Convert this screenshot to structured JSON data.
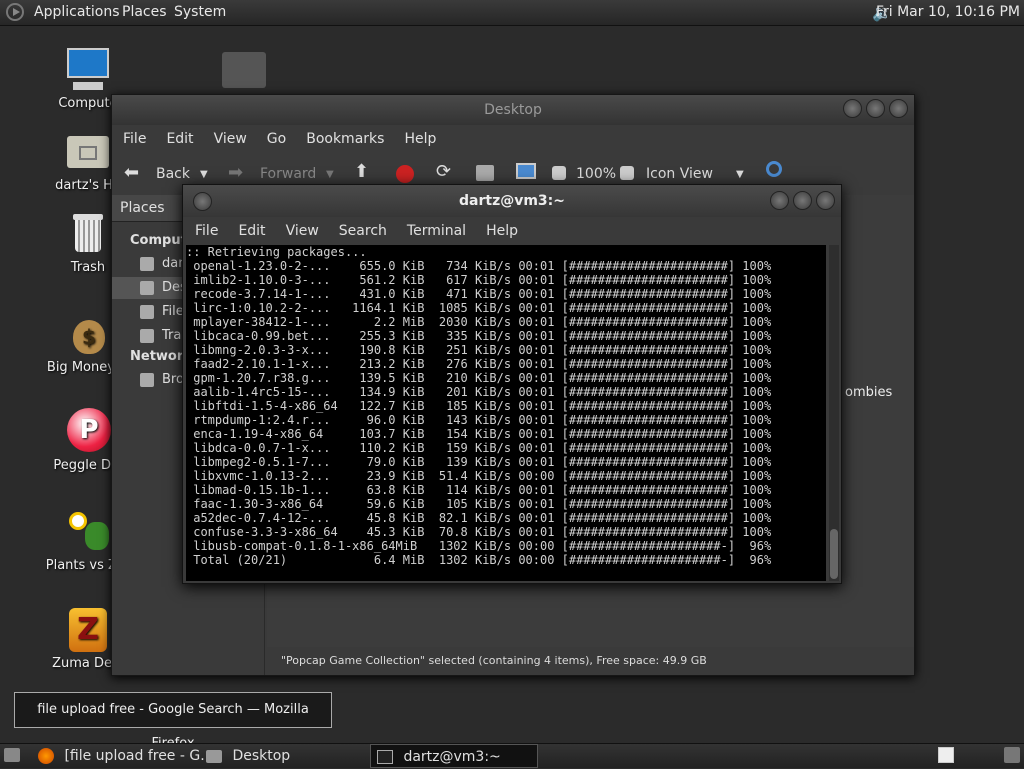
{
  "top_panel": {
    "menus": [
      "Applications",
      "Places",
      "System"
    ],
    "clock": "Fri Mar 10, 10:16 PM"
  },
  "desktop_icons": [
    {
      "label": "Compute",
      "icon": "computer-icon"
    },
    {
      "label": "dartz's Ho",
      "icon": "home-folder-icon"
    },
    {
      "label": "Trash",
      "icon": "trash-icon"
    },
    {
      "label": "Big Money D",
      "icon": "money-bag-icon"
    },
    {
      "label": "Peggle Del",
      "icon": "peggle-icon"
    },
    {
      "label": "Plants vs Zor",
      "icon": "plants-vs-zombies-icon"
    },
    {
      "label": "Zuma Delu",
      "icon": "zuma-icon"
    }
  ],
  "nautilus": {
    "title": "Desktop",
    "menus": [
      "File",
      "Edit",
      "View",
      "Go",
      "Bookmarks",
      "Help"
    ],
    "toolbar": {
      "back": "Back",
      "forward": "Forward",
      "zoom": "100%",
      "view_mode": "Icon View"
    },
    "sidebar": {
      "header": "Places",
      "section_computer": "Compute",
      "items_computer": [
        "dar",
        "Des",
        "File",
        "Tra"
      ],
      "section_network": "Network",
      "items_network": [
        "Bro"
      ]
    },
    "main_item_label": "ombies",
    "status": "\"Popcap Game Collection\" selected (containing 4 items), Free space: 49.9 GB"
  },
  "terminal": {
    "title": "dartz@vm3:~",
    "menus": [
      "File",
      "Edit",
      "View",
      "Search",
      "Terminal",
      "Help"
    ],
    "lines": [
      ":: Retrieving packages...",
      " openal-1.23.0-2-...    655.0 KiB   734 KiB/s 00:01 [######################] 100%",
      " imlib2-1.10.0-3-...    561.2 KiB   617 KiB/s 00:01 [######################] 100%",
      " recode-3.7.14-1-...    431.0 KiB   471 KiB/s 00:01 [######################] 100%",
      " lirc-1:0.10.2-2-...   1164.1 KiB  1085 KiB/s 00:01 [######################] 100%",
      " mplayer-38412-1-...      2.2 MiB  2030 KiB/s 00:01 [######################] 100%",
      " libcaca-0.99.bet...    255.3 KiB   335 KiB/s 00:01 [######################] 100%",
      " libmng-2.0.3-3-x...    190.8 KiB   251 KiB/s 00:01 [######################] 100%",
      " faad2-2.10.1-1-x...    213.2 KiB   276 KiB/s 00:01 [######################] 100%",
      " gpm-1.20.7.r38.g...    139.5 KiB   210 KiB/s 00:01 [######################] 100%",
      " aalib-1.4rc5-15-...    134.9 KiB   201 KiB/s 00:01 [######################] 100%",
      " libftdi-1.5-4-x86_64   122.7 KiB   185 KiB/s 00:01 [######################] 100%",
      " rtmpdump-1:2.4.r...     96.0 KiB   143 KiB/s 00:01 [######################] 100%",
      " enca-1.19-4-x86_64     103.7 KiB   154 KiB/s 00:01 [######################] 100%",
      " libdca-0.0.7-1-x...    110.2 KiB   159 KiB/s 00:01 [######################] 100%",
      " libmpeg2-0.5.1-7...     79.0 KiB   139 KiB/s 00:01 [######################] 100%",
      " libxvmc-1.0.13-2...     23.9 KiB  51.4 KiB/s 00:00 [######################] 100%",
      " libmad-0.15.1b-1...     63.8 KiB   114 KiB/s 00:01 [######################] 100%",
      " faac-1.30-3-x86_64      59.6 KiB   105 KiB/s 00:01 [######################] 100%",
      " a52dec-0.7.4-12-...     45.8 KiB  82.1 KiB/s 00:01 [######################] 100%",
      " confuse-3.3-3-x86_64    45.3 KiB  70.8 KiB/s 00:01 [######################] 100%",
      " libusb-compat-0.1.8-1-x86_64MiB   1302 KiB/s 00:00 [#####################-]  96%",
      " Total (20/21)            6.4 MiB  1302 KiB/s 00:00 [#####################-]  96%"
    ]
  },
  "tooltip": "file upload free - Google Search — Mozilla Firefox",
  "taskbar": {
    "items": [
      {
        "label": "[file upload free - G...",
        "icon": "firefox-icon"
      },
      {
        "label": "Desktop",
        "icon": "folder-icon"
      },
      {
        "label": "dartz@vm3:~",
        "icon": "terminal-icon"
      }
    ]
  },
  "colors": {
    "terminal_bg": "#000000",
    "panel": "#2b2b2b"
  }
}
